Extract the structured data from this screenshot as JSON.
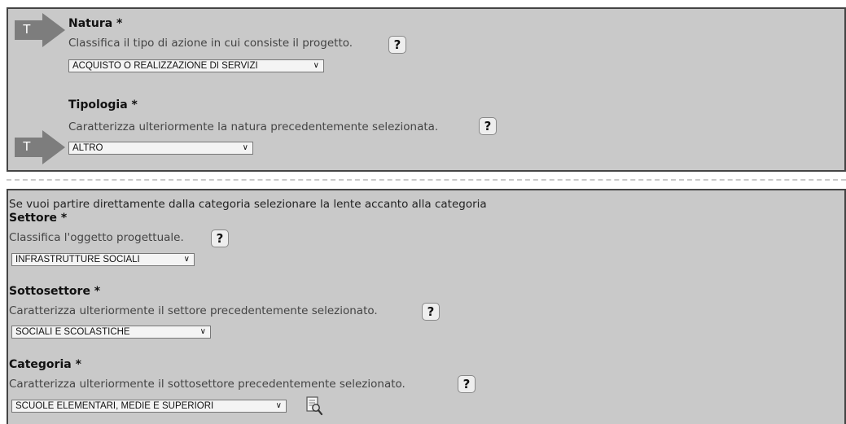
{
  "natura": {
    "arrow_letter": "T",
    "label": "Natura *",
    "description": "Classifica il tipo di azione in cui consiste il progetto.",
    "help": "?",
    "selected": "ACQUISTO O REALIZZAZIONE DI SERVIZI"
  },
  "tipologia": {
    "arrow_letter": "T",
    "label": "Tipologia *",
    "description": "Caratterizza ulteriormente la natura precedentemente selezionata.",
    "help": "?",
    "selected": "ALTRO"
  },
  "intro": "Se vuoi partire direttamente dalla categoria selezionare la lente accanto alla categoria",
  "settore": {
    "label": "Settore *",
    "description": "Classifica l'oggetto progettuale.",
    "help": "?",
    "selected": "INFRASTRUTTURE SOCIALI"
  },
  "sottosettore": {
    "label": "Sottosettore *",
    "description": "Caratterizza ulteriormente il settore precedentemente selezionato.",
    "help": "?",
    "selected": "SOCIALI E SCOLASTICHE"
  },
  "categoria": {
    "label": "Categoria *",
    "description": "Caratterizza ulteriormente il sottosettore precedentemente selezionato.",
    "help": "?",
    "selected": "SCUOLE ELEMENTARI, MEDIE E SUPERIORI",
    "lens_icon": "search-document-icon"
  },
  "chevron": "∨"
}
